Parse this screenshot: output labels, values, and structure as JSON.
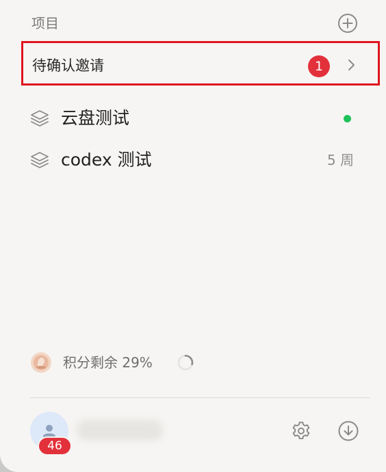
{
  "sidebar": {
    "section_title": "项目",
    "add_icon": "plus-circle-icon",
    "pending": {
      "label": "待确认邀请",
      "count": "1",
      "chevron_icon": "chevron-right-icon"
    },
    "projects": [
      {
        "name": "云盘测试",
        "icon": "layers-icon",
        "status": "online-dot",
        "time": ""
      },
      {
        "name": "codex 测试",
        "icon": "layers-icon",
        "status": "",
        "time": "5 周"
      }
    ],
    "credits": {
      "label": "积分剩余 29%",
      "remaining_fraction": 0.29
    },
    "user": {
      "notification_count": "46"
    },
    "footer_icons": [
      "gear-icon",
      "download-icon"
    ],
    "colors": {
      "accent_red": "#e2313b",
      "highlight_border": "#e0141e",
      "online_green": "#1fc15a",
      "panel_bg": "#f6f5f3"
    }
  }
}
